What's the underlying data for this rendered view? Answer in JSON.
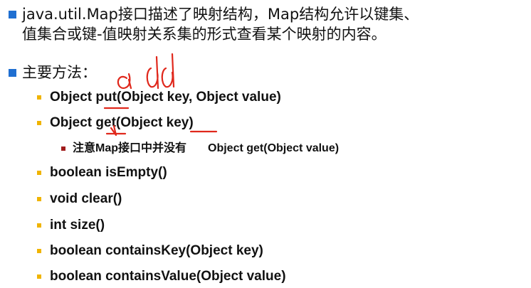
{
  "intro": {
    "line1": "java.util.Map接口描述了映射结构，Map结构允许以键集、",
    "line2": "值集合或键-值映射关系集的形式查看某个映射的内容。"
  },
  "section": {
    "title": "主要方法："
  },
  "methods": [
    "Object put(Object key, Object value)",
    "Object get(Object key)",
    "boolean isEmpty()",
    "void clear()",
    "int size()",
    "boolean containsKey(Object key)",
    "boolean containsValue(Object value)"
  ],
  "note": {
    "text": "注意Map接口中并没有",
    "code": "Object get(Object value)"
  },
  "colors": {
    "level1_bullet": "#1f6fd1",
    "level2_bullet": "#f0b400",
    "level3_bullet": "#a01c1c",
    "annotation_ink": "#e0281c"
  }
}
